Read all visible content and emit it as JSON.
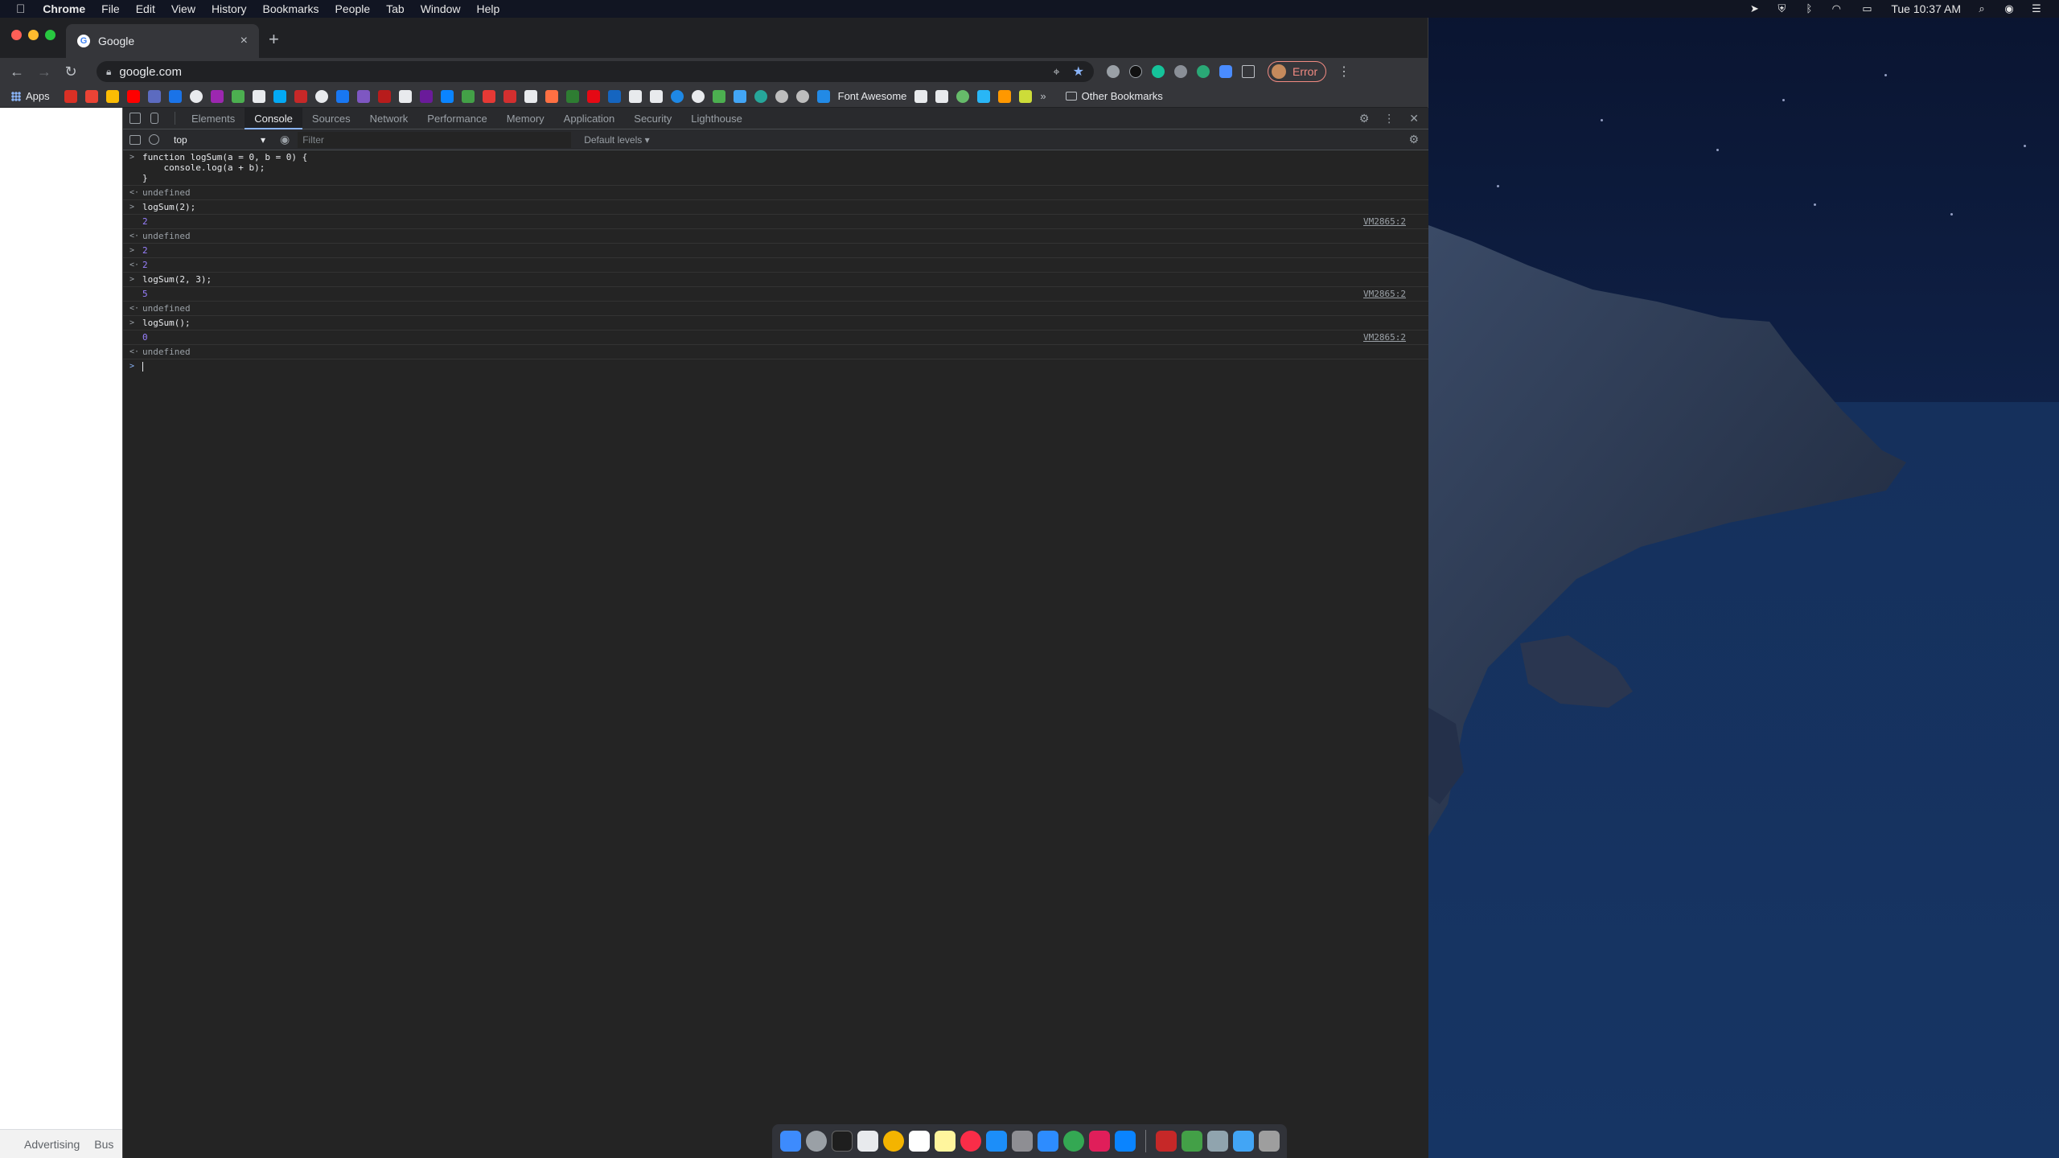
{
  "menubar": {
    "app_name": "Chrome",
    "items": [
      "File",
      "Edit",
      "View",
      "History",
      "Bookmarks",
      "People",
      "Tab",
      "Window",
      "Help"
    ],
    "clock": "Tue 10:37 AM"
  },
  "browser": {
    "tab_title": "Google",
    "url": "google.com",
    "profile_label": "Error",
    "bookmarks": {
      "apps_label": "Apps",
      "named_bookmark": "Font Awesome",
      "other_label": "Other Bookmarks"
    }
  },
  "page": {
    "footer_links": [
      "Advertising",
      "Bus"
    ]
  },
  "devtools": {
    "tabs": [
      "Elements",
      "Console",
      "Sources",
      "Network",
      "Performance",
      "Memory",
      "Application",
      "Security",
      "Lighthouse"
    ],
    "active_tab": "Console",
    "context": "top",
    "filter_placeholder": "Filter",
    "levels_label": "Default levels ▾",
    "console": [
      {
        "kind": "input",
        "text": "function logSum(a = 0, b = 0) {\n    console.log(a + b);\n}"
      },
      {
        "kind": "result",
        "text": "undefined"
      },
      {
        "kind": "input",
        "text": "logSum(2);"
      },
      {
        "kind": "log",
        "text": "2",
        "source": "VM2865:2"
      },
      {
        "kind": "result",
        "text": "undefined"
      },
      {
        "kind": "input",
        "text": "2"
      },
      {
        "kind": "result",
        "text": "2"
      },
      {
        "kind": "input",
        "text": "logSum(2, 3);"
      },
      {
        "kind": "log",
        "text": "5",
        "source": "VM2865:2"
      },
      {
        "kind": "result",
        "text": "undefined"
      },
      {
        "kind": "input",
        "text": "logSum();"
      },
      {
        "kind": "log",
        "text": "0",
        "source": "VM2865:2"
      },
      {
        "kind": "result",
        "text": "undefined"
      }
    ]
  }
}
